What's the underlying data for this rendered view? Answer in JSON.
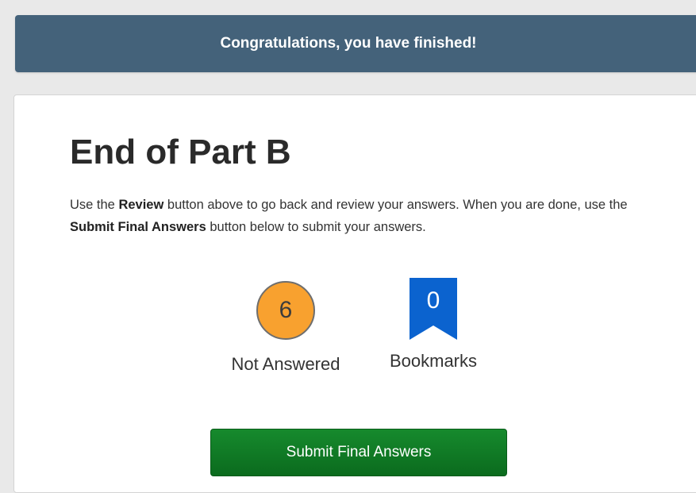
{
  "banner": {
    "text": "Congratulations, you have finished!"
  },
  "main": {
    "title": "End of Part B",
    "instructions": {
      "part1": "Use the ",
      "review_bold": "Review",
      "part2": " button above to go back and review your answers. When you are done, use the ",
      "submit_bold": "Submit Final Answers",
      "part3": " button below to submit your answers."
    },
    "stats": {
      "not_answered": {
        "count": "6",
        "label": "Not Answered"
      },
      "bookmarks": {
        "count": "0",
        "label": "Bookmarks"
      }
    },
    "submit_label": "Submit Final Answers"
  },
  "colors": {
    "banner_bg": "#44627a",
    "not_answered_badge": "#f8a12f",
    "bookmark_badge": "#0b63cf",
    "submit_button": "#0f7a25"
  },
  "icons": {
    "not_answered": "circle-badge",
    "bookmarks": "bookmark-icon"
  }
}
